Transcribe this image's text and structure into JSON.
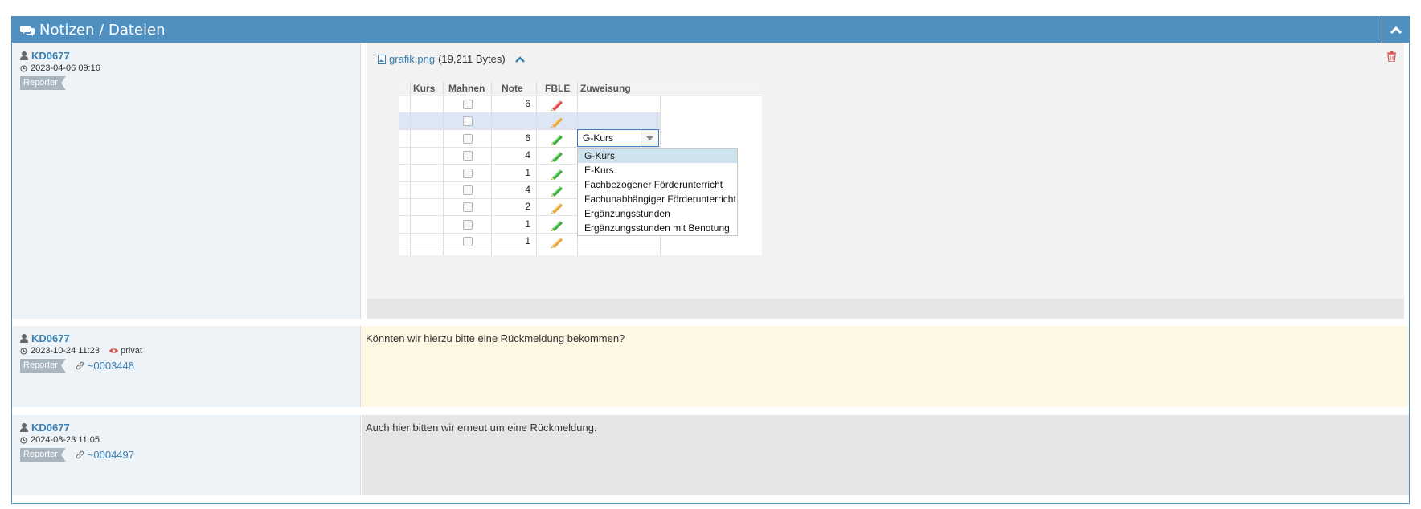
{
  "header": {
    "title": "Notizen / Dateien"
  },
  "notes": [
    {
      "user": "KD0677",
      "datetime": "2023-04-06 09:16",
      "role": "Reporter",
      "attachment": {
        "filename": "grafik.png",
        "size": "(19,211 Bytes)",
        "image": {
          "columns": [
            "Kurs",
            "Mahnen",
            "Note",
            "FBLE",
            "Zuweisung"
          ],
          "rows": [
            {
              "note": "6",
              "pencil": "red"
            },
            {
              "note": "",
              "pencil": "orange"
            },
            {
              "note": "6",
              "pencil": "green"
            },
            {
              "note": "4",
              "pencil": "green"
            },
            {
              "note": "1",
              "pencil": "green"
            },
            {
              "note": "4",
              "pencil": "green"
            },
            {
              "note": "2",
              "pencil": "orange"
            },
            {
              "note": "1",
              "pencil": "green"
            },
            {
              "note": "1",
              "pencil": "orange"
            }
          ],
          "combo_value": "G-Kurs",
          "options": [
            "G-Kurs",
            "E-Kurs",
            "Fachbezogener Förderunterricht",
            "Fachunabhängiger Förderunterricht",
            "Ergänzungsstunden",
            "Ergänzungsstunden mit Benotung"
          ]
        }
      }
    },
    {
      "user": "KD0677",
      "datetime": "2023-10-24 11:23",
      "visibility": "privat",
      "role": "Reporter",
      "ref": "~0003448",
      "text": "Könnten wir hierzu bitte eine Rückmeldung bekommen?"
    },
    {
      "user": "KD0677",
      "datetime": "2024-08-23 11:05",
      "role": "Reporter",
      "ref": "~0004497",
      "text": "Auch hier bitten wir erneut um eine Rückmeldung."
    }
  ],
  "colors": {
    "header": "#5090c1",
    "link": "#3a80b5",
    "private_note": "#fdf7e3",
    "note": "#e6e6e6"
  },
  "icons": [
    "comments-icon",
    "chevron-up-icon",
    "user-icon",
    "clock-icon",
    "eye-icon",
    "link-icon",
    "image-file-icon",
    "trash-icon"
  ]
}
